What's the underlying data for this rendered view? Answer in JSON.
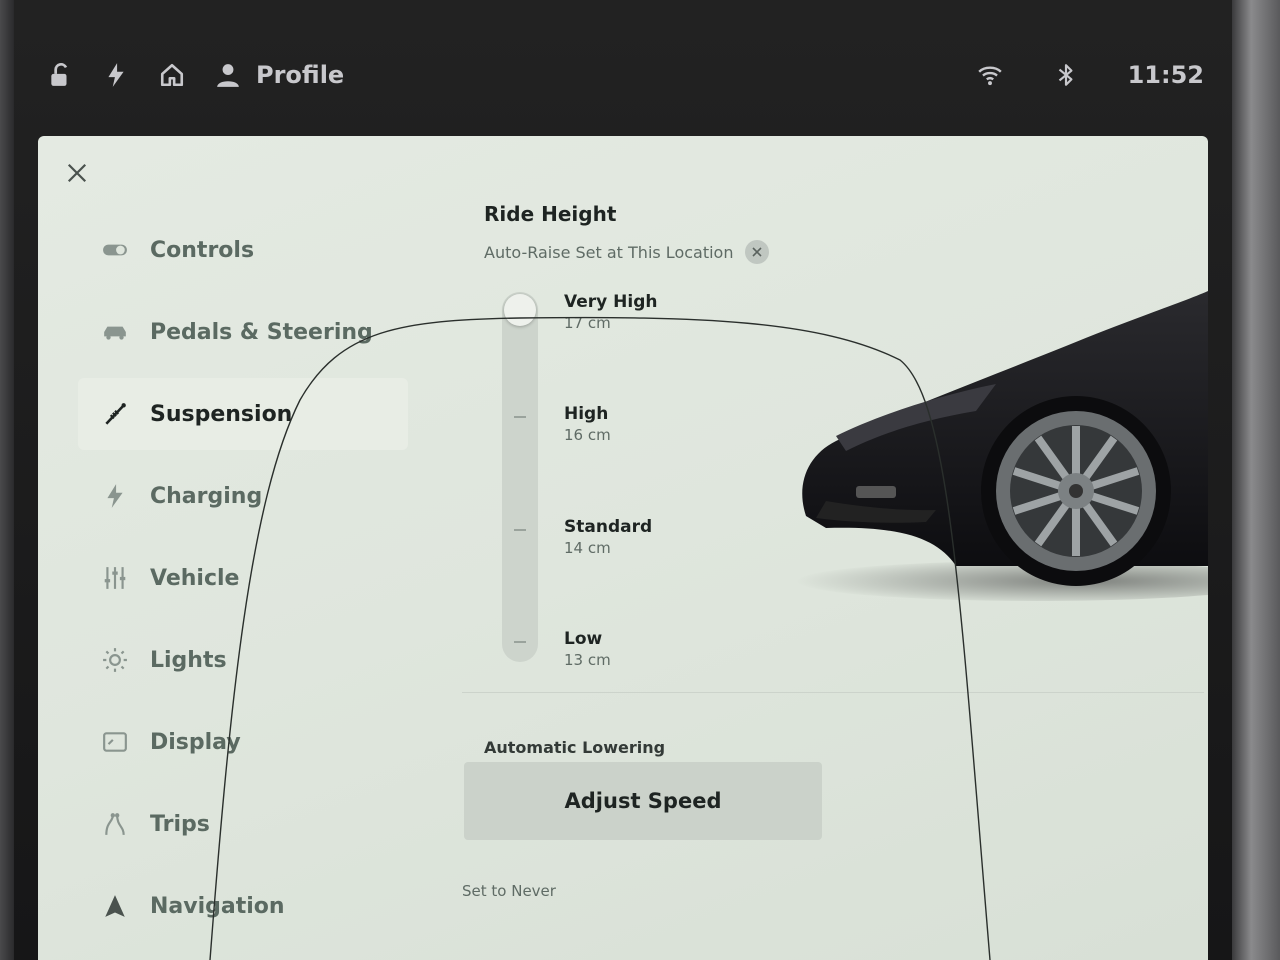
{
  "status_bar": {
    "profile_label": "Profile",
    "clock": "11:52",
    "icons": [
      "lock-open-icon",
      "bolt-icon",
      "home-icon",
      "person-icon",
      "wifi-icon",
      "bluetooth-icon"
    ]
  },
  "sidebar": {
    "items": [
      {
        "label": "Controls",
        "icon": "toggle-icon",
        "active": false
      },
      {
        "label": "Pedals & Steering",
        "icon": "car-icon",
        "active": false
      },
      {
        "label": "Suspension",
        "icon": "suspension-icon",
        "active": true
      },
      {
        "label": "Charging",
        "icon": "bolt-icon",
        "active": false
      },
      {
        "label": "Vehicle",
        "icon": "sliders-icon",
        "active": false
      },
      {
        "label": "Lights",
        "icon": "sun-icon",
        "active": false
      },
      {
        "label": "Display",
        "icon": "display-icon",
        "active": false
      },
      {
        "label": "Trips",
        "icon": "trips-icon",
        "active": false
      },
      {
        "label": "Navigation",
        "icon": "navigation-icon",
        "active": false
      }
    ]
  },
  "ride_height": {
    "title": "Ride Height",
    "auto_raise": "Auto-Raise Set at This Location",
    "selected": "Very High",
    "levels": [
      {
        "name": "Very High",
        "value": "17 cm"
      },
      {
        "name": "High",
        "value": "16 cm"
      },
      {
        "name": "Standard",
        "value": "14 cm"
      },
      {
        "name": "Low",
        "value": "13 cm"
      }
    ]
  },
  "automatic_lowering": {
    "label": "Automatic Lowering",
    "button": "Adjust Speed",
    "status": "Set to Never"
  },
  "colors": {
    "panel_bg": "#e2e8e0",
    "text_primary": "#1e2422",
    "text_secondary": "#5f6b65",
    "status_text": "#c8c8cc"
  }
}
